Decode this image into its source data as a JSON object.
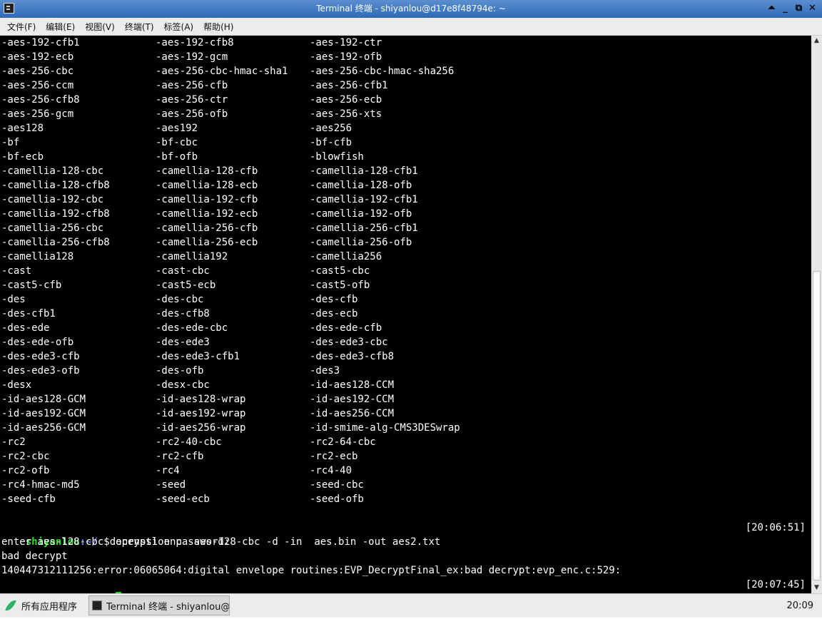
{
  "window": {
    "title": "Terminal 终端 - shiyanlou@d17e8f48794e: ~",
    "buttons": [
      "⏶",
      "_",
      "⧉",
      "✕"
    ]
  },
  "menubar": [
    "文件(F)",
    "编辑(E)",
    "视图(V)",
    "终端(T)",
    "标签(A)",
    "帮助(H)"
  ],
  "cipher_rows": [
    [
      "-aes-192-cfb1",
      "-aes-192-cfb8",
      "-aes-192-ctr"
    ],
    [
      "-aes-192-ecb",
      "-aes-192-gcm",
      "-aes-192-ofb"
    ],
    [
      "-aes-256-cbc",
      "-aes-256-cbc-hmac-sha1",
      "-aes-256-cbc-hmac-sha256"
    ],
    [
      "-aes-256-ccm",
      "-aes-256-cfb",
      "-aes-256-cfb1"
    ],
    [
      "-aes-256-cfb8",
      "-aes-256-ctr",
      "-aes-256-ecb"
    ],
    [
      "-aes-256-gcm",
      "-aes-256-ofb",
      "-aes-256-xts"
    ],
    [
      "-aes128",
      "-aes192",
      "-aes256"
    ],
    [
      "-bf",
      "-bf-cbc",
      "-bf-cfb"
    ],
    [
      "-bf-ecb",
      "-bf-ofb",
      "-blowfish"
    ],
    [
      "-camellia-128-cbc",
      "-camellia-128-cfb",
      "-camellia-128-cfb1"
    ],
    [
      "-camellia-128-cfb8",
      "-camellia-128-ecb",
      "-camellia-128-ofb"
    ],
    [
      "-camellia-192-cbc",
      "-camellia-192-cfb",
      "-camellia-192-cfb1"
    ],
    [
      "-camellia-192-cfb8",
      "-camellia-192-ecb",
      "-camellia-192-ofb"
    ],
    [
      "-camellia-256-cbc",
      "-camellia-256-cfb",
      "-camellia-256-cfb1"
    ],
    [
      "-camellia-256-cfb8",
      "-camellia-256-ecb",
      "-camellia-256-ofb"
    ],
    [
      "-camellia128",
      "-camellia192",
      "-camellia256"
    ],
    [
      "-cast",
      "-cast-cbc",
      "-cast5-cbc"
    ],
    [
      "-cast5-cfb",
      "-cast5-ecb",
      "-cast5-ofb"
    ],
    [
      "-des",
      "-des-cbc",
      "-des-cfb"
    ],
    [
      "-des-cfb1",
      "-des-cfb8",
      "-des-ecb"
    ],
    [
      "-des-ede",
      "-des-ede-cbc",
      "-des-ede-cfb"
    ],
    [
      "-des-ede-ofb",
      "-des-ede3",
      "-des-ede3-cbc"
    ],
    [
      "-des-ede3-cfb",
      "-des-ede3-cfb1",
      "-des-ede3-cfb8"
    ],
    [
      "-des-ede3-ofb",
      "-des-ofb",
      "-des3"
    ],
    [
      "-desx",
      "-desx-cbc",
      "-id-aes128-CCM"
    ],
    [
      "-id-aes128-GCM",
      "-id-aes128-wrap",
      "-id-aes192-CCM"
    ],
    [
      "-id-aes192-GCM",
      "-id-aes192-wrap",
      "-id-aes256-CCM"
    ],
    [
      "-id-aes256-GCM",
      "-id-aes256-wrap",
      "-id-smime-alg-CMS3DESwrap"
    ],
    [
      "-rc2",
      "-rc2-40-cbc",
      "-rc2-64-cbc"
    ],
    [
      "-rc2-cbc",
      "-rc2-cfb",
      "-rc2-ecb"
    ],
    [
      "-rc2-ofb",
      "-rc4",
      "-rc4-40"
    ],
    [
      "-rc4-hmac-md5",
      "-seed",
      "-seed-cbc"
    ],
    [
      "-seed-cfb",
      "-seed-ecb",
      "-seed-ofb"
    ]
  ],
  "session": {
    "prompt_user": "shiyanlou",
    "prompt_path": ":~/",
    "prompt_symbol": " $ ",
    "command": "openssl enc -aes-128-cbc -d -in  aes.bin -out aes2.txt",
    "command_time": "[20:06:51]",
    "output": [
      "enter aes-128-cbc decryption password:",
      "bad decrypt",
      "140447312111256:error:06065064:digital envelope routines:EVP_DecryptFinal_ex:bad decrypt:evp_enc.c:529:"
    ],
    "current_time": "[20:07:45]"
  },
  "taskbar": {
    "start_label": "所有应用程序",
    "task_label": "Terminal 终端 - shiyanlou@…",
    "clock": "20:09"
  },
  "colors": {
    "terminal_bg": "#000000",
    "terminal_fg": "#ffffff",
    "prompt_user": "#22dd22",
    "prompt_path": "#6a8cff",
    "titlebar": "#2f69b8"
  }
}
